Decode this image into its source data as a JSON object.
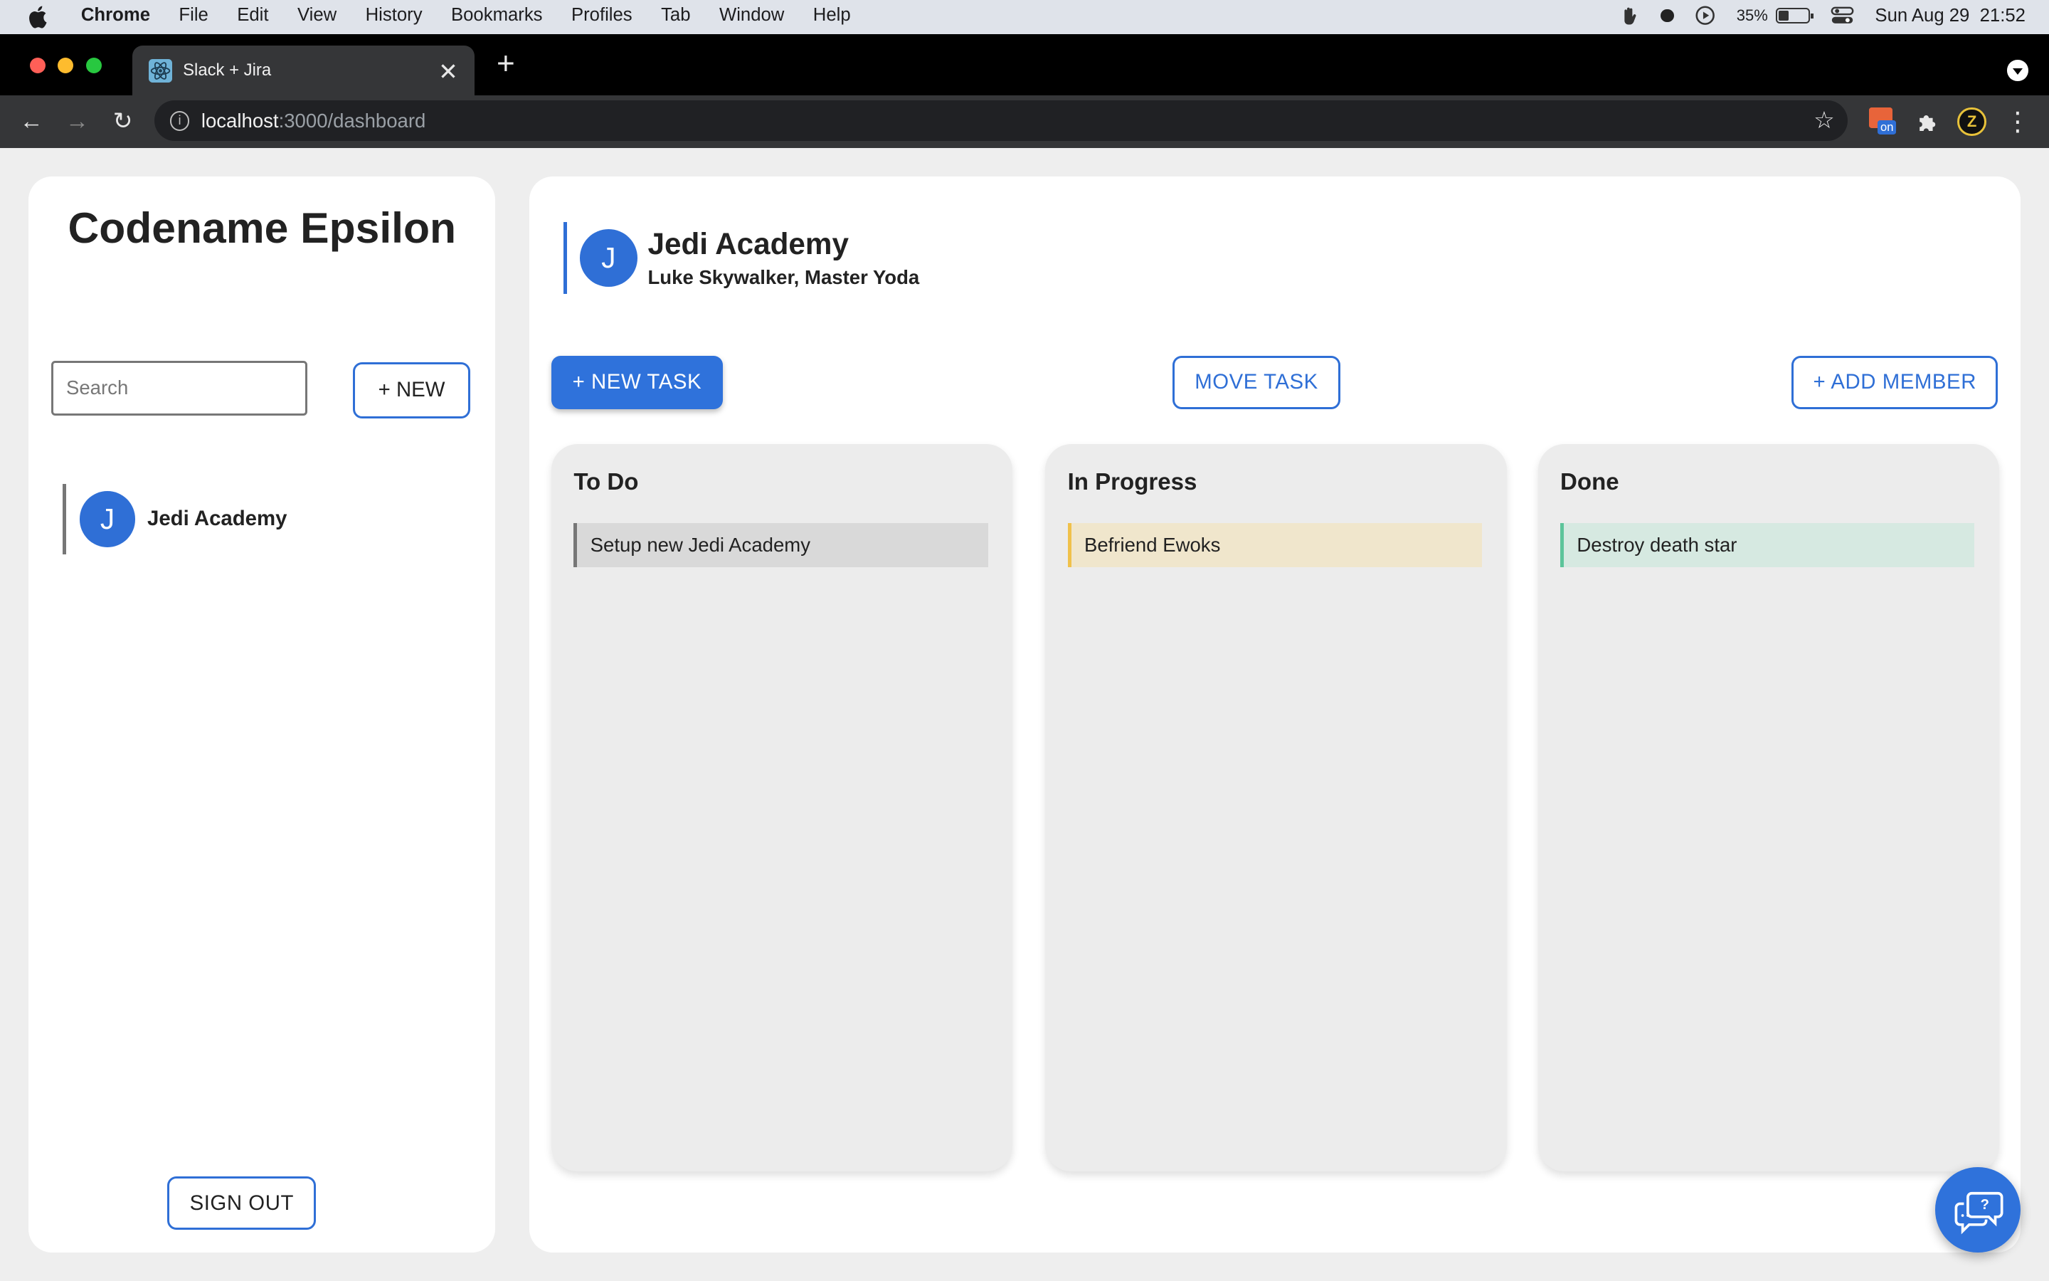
{
  "menubar": {
    "app_name": "Chrome",
    "items": [
      "File",
      "Edit",
      "View",
      "History",
      "Bookmarks",
      "Profiles",
      "Tab",
      "Window",
      "Help"
    ],
    "battery_percent": "35%",
    "battery_level": 0.35,
    "datetime": "Sun Aug 29  21:52"
  },
  "browser": {
    "tab_title": "Slack + Jira",
    "url_host": "localhost",
    "url_path": ":3000/dashboard",
    "extension_badge": "on"
  },
  "sidebar": {
    "app_title": "Codename Epsilon",
    "search_placeholder": "Search",
    "new_label": "+ NEW",
    "channels": [
      {
        "initial": "J",
        "name": "Jedi Academy"
      }
    ],
    "signout_label": "SIGN OUT"
  },
  "project": {
    "initial": "J",
    "title": "Jedi Academy",
    "members": "Luke Skywalker, Master Yoda"
  },
  "actions": {
    "new_task": "+ NEW TASK",
    "move_task": "MOVE TASK",
    "add_member": "+ ADD MEMBER"
  },
  "columns": [
    {
      "title": "To Do",
      "tasks": [
        {
          "text": "Setup new Jedi Academy",
          "bg": "#d9d9d9",
          "accent": "#777777"
        }
      ]
    },
    {
      "title": "In Progress",
      "tasks": [
        {
          "text": "Befriend Ewoks",
          "bg": "#f0e6cc",
          "accent": "#f0c14b"
        }
      ]
    },
    {
      "title": "Done",
      "tasks": [
        {
          "text": "Destroy death star",
          "bg": "#d6e9e1",
          "accent": "#5cc49a"
        }
      ]
    }
  ],
  "colors": {
    "accent": "#2f72db"
  }
}
